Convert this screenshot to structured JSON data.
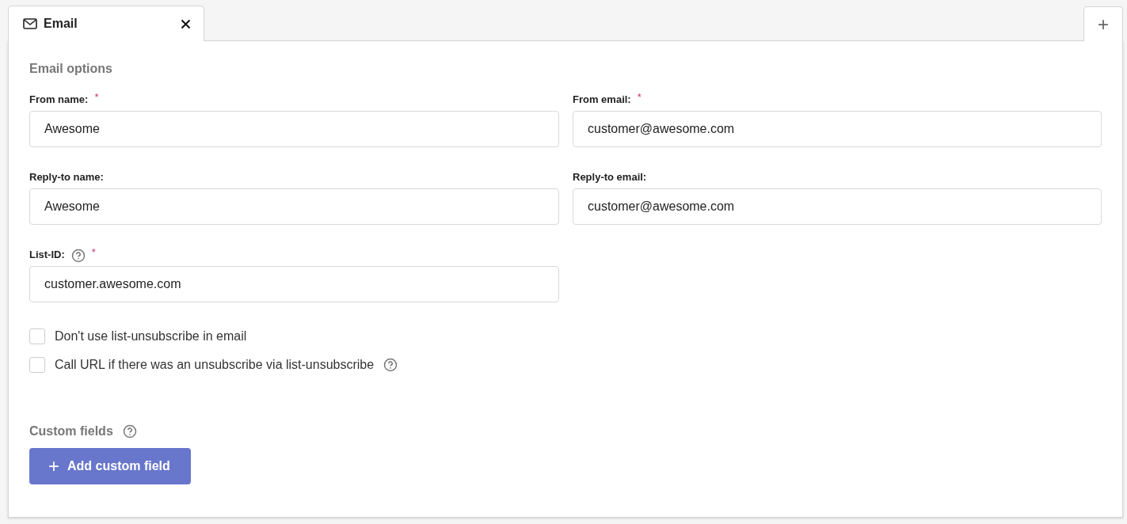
{
  "tabs": [
    {
      "label": "Email",
      "selected": true
    }
  ],
  "add_tab": {
    "label": "+"
  },
  "email_options": {
    "title": "Email options",
    "fields": [
      {
        "label": "From name:",
        "value": "Awesome",
        "required_mark": "*",
        "help": false
      },
      {
        "label": "From email:",
        "value": "customer@awesome.com",
        "required_mark": "*",
        "help": false
      },
      {
        "label": "Reply-to name:",
        "value": "Awesome",
        "help": false
      },
      {
        "label": "Reply-to email:",
        "value": "customer@awesome.com",
        "help": false
      },
      {
        "label": "List-ID:",
        "value": "customer.awesome.com",
        "required_mark": "*",
        "help": true
      }
    ],
    "checkboxes": [
      {
        "label": "Don't use list-unsubscribe in email",
        "checked": false,
        "help": false
      },
      {
        "label": "Call URL if there was an unsubscribe via list-unsubscribe",
        "checked": false,
        "help": true
      }
    ]
  },
  "custom_fields": {
    "title": "Custom fields",
    "help": true,
    "button": {
      "icon": "+",
      "label": "Add custom field"
    }
  }
}
